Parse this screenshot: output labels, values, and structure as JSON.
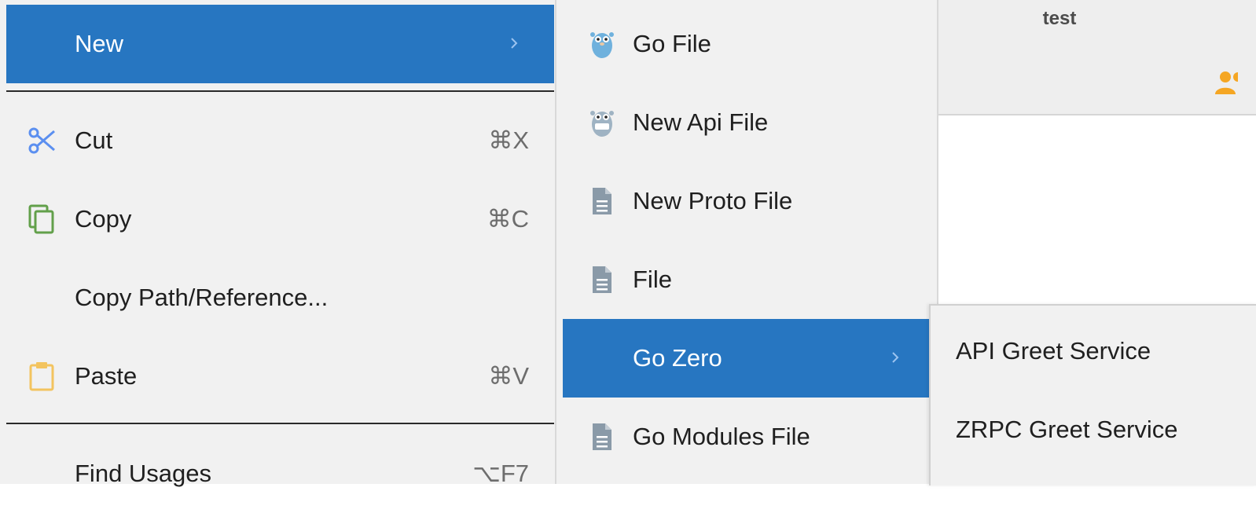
{
  "background_window": {
    "title": "test",
    "icon": "person-icon"
  },
  "main_menu": {
    "new": {
      "label": "New",
      "icon": "chevron-right-icon"
    },
    "cut": {
      "label": "Cut",
      "shortcut": "⌘X",
      "icon": "scissors-icon"
    },
    "copy": {
      "label": "Copy",
      "shortcut": "⌘C",
      "icon": "copy-icon"
    },
    "copy_path": {
      "label": "Copy Path/Reference..."
    },
    "paste": {
      "label": "Paste",
      "shortcut": "⌘V",
      "icon": "clipboard-icon"
    },
    "find_usages": {
      "label": "Find Usages",
      "shortcut": "⌥F7"
    }
  },
  "new_submenu": {
    "items": [
      {
        "label": "Go File",
        "icon": "gopher-icon"
      },
      {
        "label": "New Api File",
        "icon": "gozero-gopher-icon"
      },
      {
        "label": "New Proto File",
        "icon": "file-icon"
      },
      {
        "label": "File",
        "icon": "file-icon"
      },
      {
        "label": "Go Zero",
        "icon": "chevron-right-icon"
      },
      {
        "label": "Go Modules File",
        "icon": "file-icon"
      }
    ]
  },
  "go_zero_submenu": {
    "items": [
      {
        "label": "API Greet Service"
      },
      {
        "label": "ZRPC Greet Service"
      }
    ]
  },
  "colors": {
    "selection": "#2776c1",
    "menu_bg": "#f1f1f1",
    "scissors": "#5b8ff0",
    "copy": "#62a04a",
    "clipboard": "#f3c45f",
    "file_icon": "#8a9aa8",
    "person": "#f5a623"
  }
}
